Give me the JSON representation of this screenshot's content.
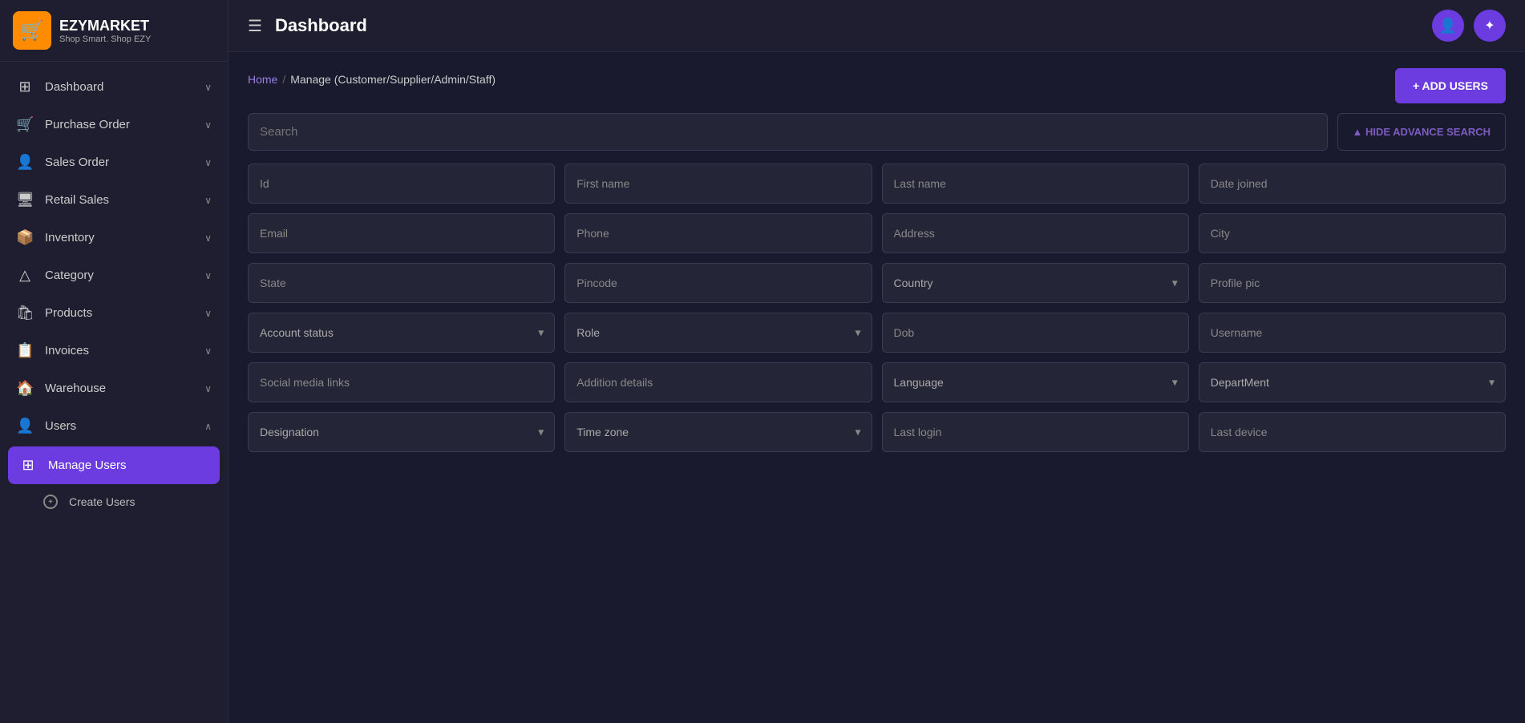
{
  "brand": {
    "icon": "🛒",
    "title": "EZYMARKET",
    "subtitle": "Shop Smart. Shop EZY"
  },
  "topbar": {
    "title": "Dashboard",
    "hamburger_label": "☰"
  },
  "breadcrumb": {
    "home": "Home",
    "separator": "/",
    "current": "Manage (Customer/Supplier/Admin/Staff)"
  },
  "buttons": {
    "add_users": "+ ADD USERS",
    "hide_search": "▲ HIDE ADVANCE SEARCH"
  },
  "search": {
    "placeholder": "Search"
  },
  "filter_fields": {
    "row1": [
      {
        "type": "input",
        "placeholder": "Id"
      },
      {
        "type": "input",
        "placeholder": "First name"
      },
      {
        "type": "input",
        "placeholder": "Last name"
      },
      {
        "type": "input",
        "placeholder": "Date joined"
      }
    ],
    "row2": [
      {
        "type": "input",
        "placeholder": "Email"
      },
      {
        "type": "input",
        "placeholder": "Phone"
      },
      {
        "type": "input",
        "placeholder": "Address"
      },
      {
        "type": "input",
        "placeholder": "City"
      }
    ],
    "row3": [
      {
        "type": "input",
        "placeholder": "State"
      },
      {
        "type": "input",
        "placeholder": "Pincode"
      },
      {
        "type": "select",
        "placeholder": "Country"
      },
      {
        "type": "input",
        "placeholder": "Profile pic"
      }
    ],
    "row4": [
      {
        "type": "select",
        "placeholder": "Account status"
      },
      {
        "type": "select",
        "placeholder": "Role"
      },
      {
        "type": "input",
        "placeholder": "Dob"
      },
      {
        "type": "input",
        "placeholder": "Username"
      }
    ],
    "row5": [
      {
        "type": "input",
        "placeholder": "Social media links"
      },
      {
        "type": "input",
        "placeholder": "Addition details"
      },
      {
        "type": "select",
        "placeholder": "Language"
      },
      {
        "type": "select",
        "placeholder": "DepartMent"
      }
    ],
    "row6": [
      {
        "type": "select",
        "placeholder": "Designation"
      },
      {
        "type": "select",
        "placeholder": "Time zone"
      },
      {
        "type": "input",
        "placeholder": "Last login"
      },
      {
        "type": "input",
        "placeholder": "Last device"
      }
    ]
  },
  "sidebar": {
    "items": [
      {
        "id": "dashboard",
        "icon": "⊞",
        "label": "Dashboard",
        "expandable": true
      },
      {
        "id": "purchase-order",
        "icon": "🛒",
        "label": "Purchase Order",
        "expandable": true
      },
      {
        "id": "sales-order",
        "icon": "👤",
        "label": "Sales Order",
        "expandable": true
      },
      {
        "id": "retail-sales",
        "icon": "🖥",
        "label": "Retail Sales",
        "expandable": true
      },
      {
        "id": "inventory",
        "icon": "📦",
        "label": "Inventory",
        "expandable": true
      },
      {
        "id": "category",
        "icon": "△",
        "label": "Category",
        "expandable": true
      },
      {
        "id": "products",
        "icon": "🛍",
        "label": "Products",
        "expandable": true
      },
      {
        "id": "invoices",
        "icon": "📋",
        "label": "Invoices",
        "expandable": true
      },
      {
        "id": "warehouse",
        "icon": "🏠",
        "label": "Warehouse",
        "expandable": true
      },
      {
        "id": "users",
        "icon": "👤",
        "label": "Users",
        "expandable": true,
        "expanded": true
      }
    ],
    "sub_items": [
      {
        "id": "manage-users",
        "label": "Manage Users",
        "active": true
      },
      {
        "id": "create-users",
        "label": "Create Users"
      }
    ]
  }
}
